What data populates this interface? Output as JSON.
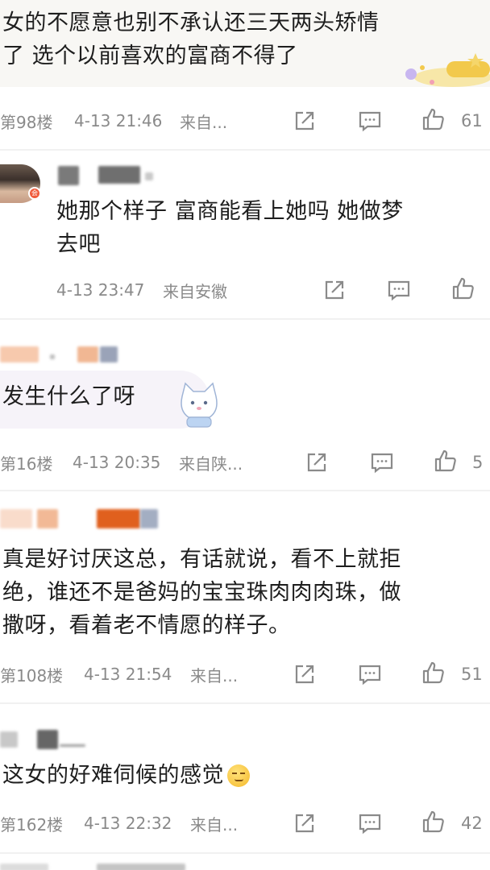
{
  "comments": [
    {
      "text_lines": [
        "女的不愿意也别不承认还三天两头矫情",
        "了 选个以前喜欢的富商不得了"
      ],
      "floor": "第98楼",
      "time": "4-13 21:46",
      "source": "来自...",
      "likes": "61"
    },
    {
      "text_lines": [
        "她那个样子 富商能看上她吗 她做梦",
        "去吧"
      ],
      "time": "4-13 23:47",
      "source": "来自安徽",
      "badge": "会"
    },
    {
      "text_lines": [
        "发生什么了呀"
      ],
      "floor": "第16楼",
      "time": "4-13 20:35",
      "source": "来自陕...",
      "likes": "5"
    },
    {
      "text_lines": [
        "真是好讨厌这总，有话就说，看不上就拒",
        "绝，谁还不是爸妈的宝宝珠肉肉肉珠，做",
        "撒呀，看着老不情愿的样子。"
      ],
      "floor": "第108楼",
      "time": "4-13 21:54",
      "source": "来自...",
      "likes": "51"
    },
    {
      "text_lines": [
        "这女的好难伺候的感觉"
      ],
      "emoji": "😏",
      "floor": "第162楼",
      "time": "4-13 22:32",
      "source": "来自...",
      "likes": "42"
    }
  ],
  "icons": {
    "repost": "repost-icon",
    "comment": "comment-icon",
    "like": "thumbs-up-icon"
  },
  "colors": {
    "meta_gray": "#8a8a8a",
    "bubble": "#f6f3f9",
    "sticker_gold": "#f2c94c",
    "username_orange": "#f5b48a",
    "username_dark_orange": "#e0601e"
  }
}
